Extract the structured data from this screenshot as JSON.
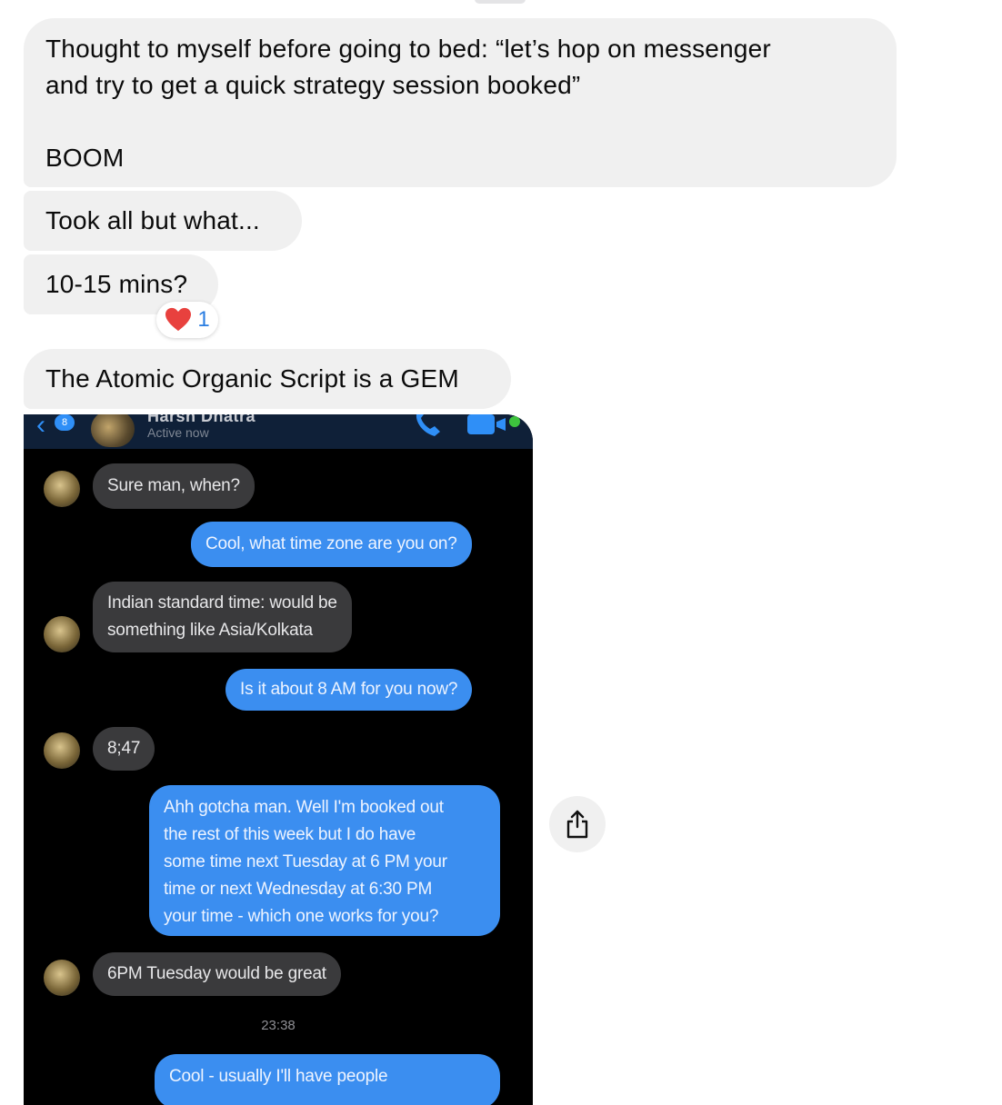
{
  "messages": [
    {
      "lines": [
        "Thought to myself before going to bed: “let’s hop on messenger",
        "and try to get a quick strategy session booked”",
        "",
        "BOOM"
      ]
    },
    {
      "text": "Took all but what..."
    },
    {
      "text": "10-15 mins?",
      "reaction": {
        "icon": "heart-icon",
        "count": "1"
      }
    },
    {
      "text": "The Atomic Organic Script is a GEM"
    }
  ],
  "screenshot": {
    "header": {
      "name": "Harsh Dhatra",
      "status": "Active now",
      "back_badge": "8"
    },
    "chat": [
      {
        "from": "them",
        "text": "Sure man, when?"
      },
      {
        "from": "me",
        "text": "Cool, what time zone are you on?"
      },
      {
        "from": "them",
        "lines": [
          "Indian standard time: would be",
          "something like Asia/Kolkata"
        ]
      },
      {
        "from": "me",
        "text": "Is it about 8 AM for you now?"
      },
      {
        "from": "them",
        "text": "8;47"
      },
      {
        "from": "me",
        "lines": [
          "Ahh gotcha man. Well I'm booked out",
          "the rest of this week but I do have",
          "some time next Tuesday at 6 PM your",
          "time or next Wednesday at 6:30 PM",
          "your time - which one works for you?"
        ]
      },
      {
        "from": "them",
        "text": "6PM Tuesday would be great"
      },
      {
        "from": "me",
        "text": "Cool - usually I'll have people"
      }
    ],
    "timestamp": "23:38"
  },
  "actions": {
    "share_icon": "share-icon"
  },
  "colors": {
    "bubble_gray": "#f0f0f0",
    "sent_blue": "#3b8ef0",
    "reaction_count": "#2a7de1"
  }
}
